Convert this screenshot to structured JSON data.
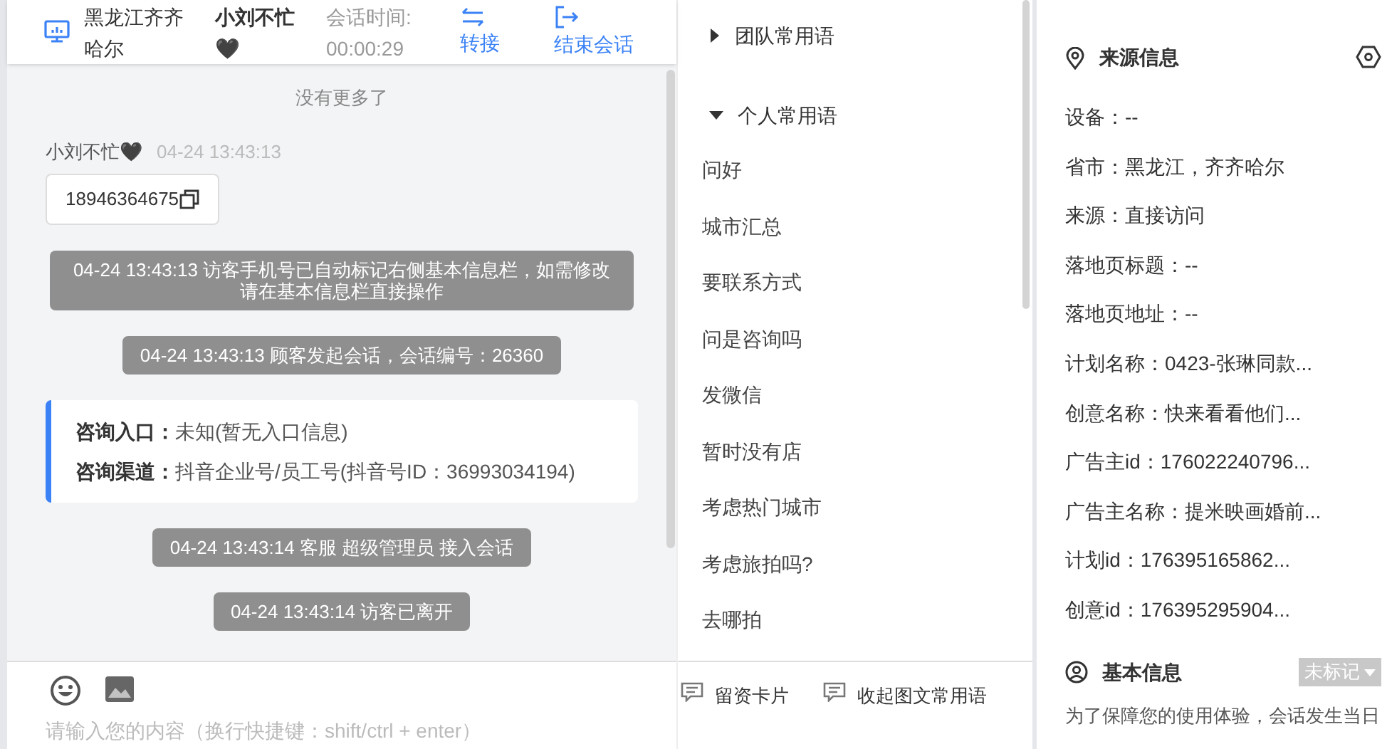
{
  "header": {
    "location": "黑龙江齐齐哈尔",
    "visitor": "小刘不忙🖤",
    "time_label": "会话时间:",
    "time_value": "00:00:29",
    "actions": [
      {
        "kind": "transfer",
        "label": "转接"
      },
      {
        "kind": "end",
        "label": "结束会话"
      }
    ]
  },
  "chat": {
    "no_more": "没有更多了",
    "messages": [
      {
        "kind": "visitor",
        "sender": "小刘不忙🖤",
        "time": "04-24 13:43:13",
        "text": "18946364675"
      },
      {
        "kind": "system",
        "text": "04-24 13:43:13 访客手机号已自动标记右侧基本信息栏，如需修改请在基本信息栏直接操作"
      },
      {
        "kind": "system",
        "text": "04-24 13:43:13 顾客发起会话，会话编号：26360"
      },
      {
        "kind": "info",
        "rows": [
          {
            "label": "咨询入口：",
            "value": "未知(暂无入口信息)"
          },
          {
            "label": "咨询渠道：",
            "value": "抖音企业号/员工号(抖音号ID：36993034194)"
          }
        ]
      },
      {
        "kind": "system",
        "text": "04-24 13:43:14 客服 超级管理员 接入会话"
      },
      {
        "kind": "system",
        "text": "04-24 13:43:14 访客已离开"
      }
    ]
  },
  "input": {
    "placeholder": "请输入您的内容（换行快捷键：shift/ctrl + enter）"
  },
  "phrases": {
    "groups": [
      {
        "label": "团队常用语",
        "expanded": false
      },
      {
        "label": "个人常用语",
        "expanded": true,
        "children": [
          {
            "label": "问好"
          },
          {
            "label": "城市汇总"
          },
          {
            "label": "要联系方式"
          },
          {
            "label": "问是咨询吗"
          },
          {
            "label": "发微信"
          },
          {
            "label": "暂时没有店"
          },
          {
            "label": "考虑热门城市"
          },
          {
            "label": "考虑旅拍吗?"
          },
          {
            "label": "去哪拍"
          }
        ]
      }
    ],
    "toolbar": [
      {
        "label": "留资卡片"
      },
      {
        "label": "收起图文常用语"
      }
    ]
  },
  "source_info": {
    "title": "来源信息",
    "fields": [
      "设备：--",
      "省市：黑龙江，齐齐哈尔",
      "来源：直接访问",
      "落地页标题：--",
      "落地页地址：--",
      "计划名称：0423-张琳同款...",
      "创意名称：快来看看他们...",
      "广告主id：176022240796...",
      "广告主名称：提米映画婚前...",
      "计划id：176395165862...",
      "创意id：176395295904..."
    ]
  },
  "basic_info": {
    "title": "基本信息",
    "tag": "未标记",
    "notice": "为了保障您的使用体验，会话发生当日"
  }
}
